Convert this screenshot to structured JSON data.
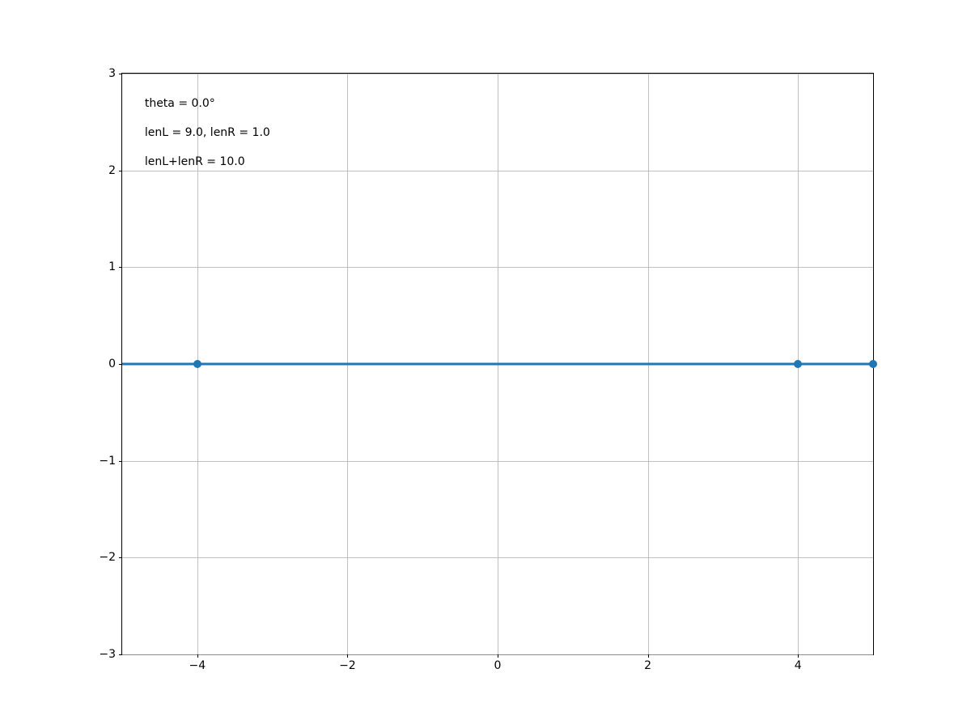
{
  "chart_data": {
    "type": "line",
    "xlim": [
      -5,
      5
    ],
    "ylim": [
      -3,
      3
    ],
    "xticks": [
      -4,
      -2,
      0,
      2,
      4
    ],
    "yticks": [
      -3,
      -2,
      -1,
      0,
      1,
      2,
      3
    ],
    "xtick_labels": [
      "−4",
      "−2",
      "0",
      "2",
      "4"
    ],
    "ytick_labels": [
      "−3",
      "−2",
      "−1",
      "0",
      "1",
      "2",
      "3"
    ],
    "series": [
      {
        "name": "segment",
        "x": [
          -5,
          -4,
          4,
          5
        ],
        "y": [
          0,
          0,
          0,
          0
        ],
        "marker_x": [
          -4,
          4,
          5
        ],
        "marker_y": [
          0,
          0,
          0
        ]
      }
    ],
    "annotations": [
      {
        "text": "theta = 0.0°",
        "x": -4.7,
        "y": 2.7
      },
      {
        "text": "lenL = 9.0, lenR = 1.0",
        "x": -4.7,
        "y": 2.4
      },
      {
        "text": "lenL+lenR = 10.0",
        "x": -4.7,
        "y": 2.1
      }
    ],
    "title": "",
    "xlabel": "",
    "ylabel": "",
    "line_color": "#1f77b4",
    "grid": true
  }
}
